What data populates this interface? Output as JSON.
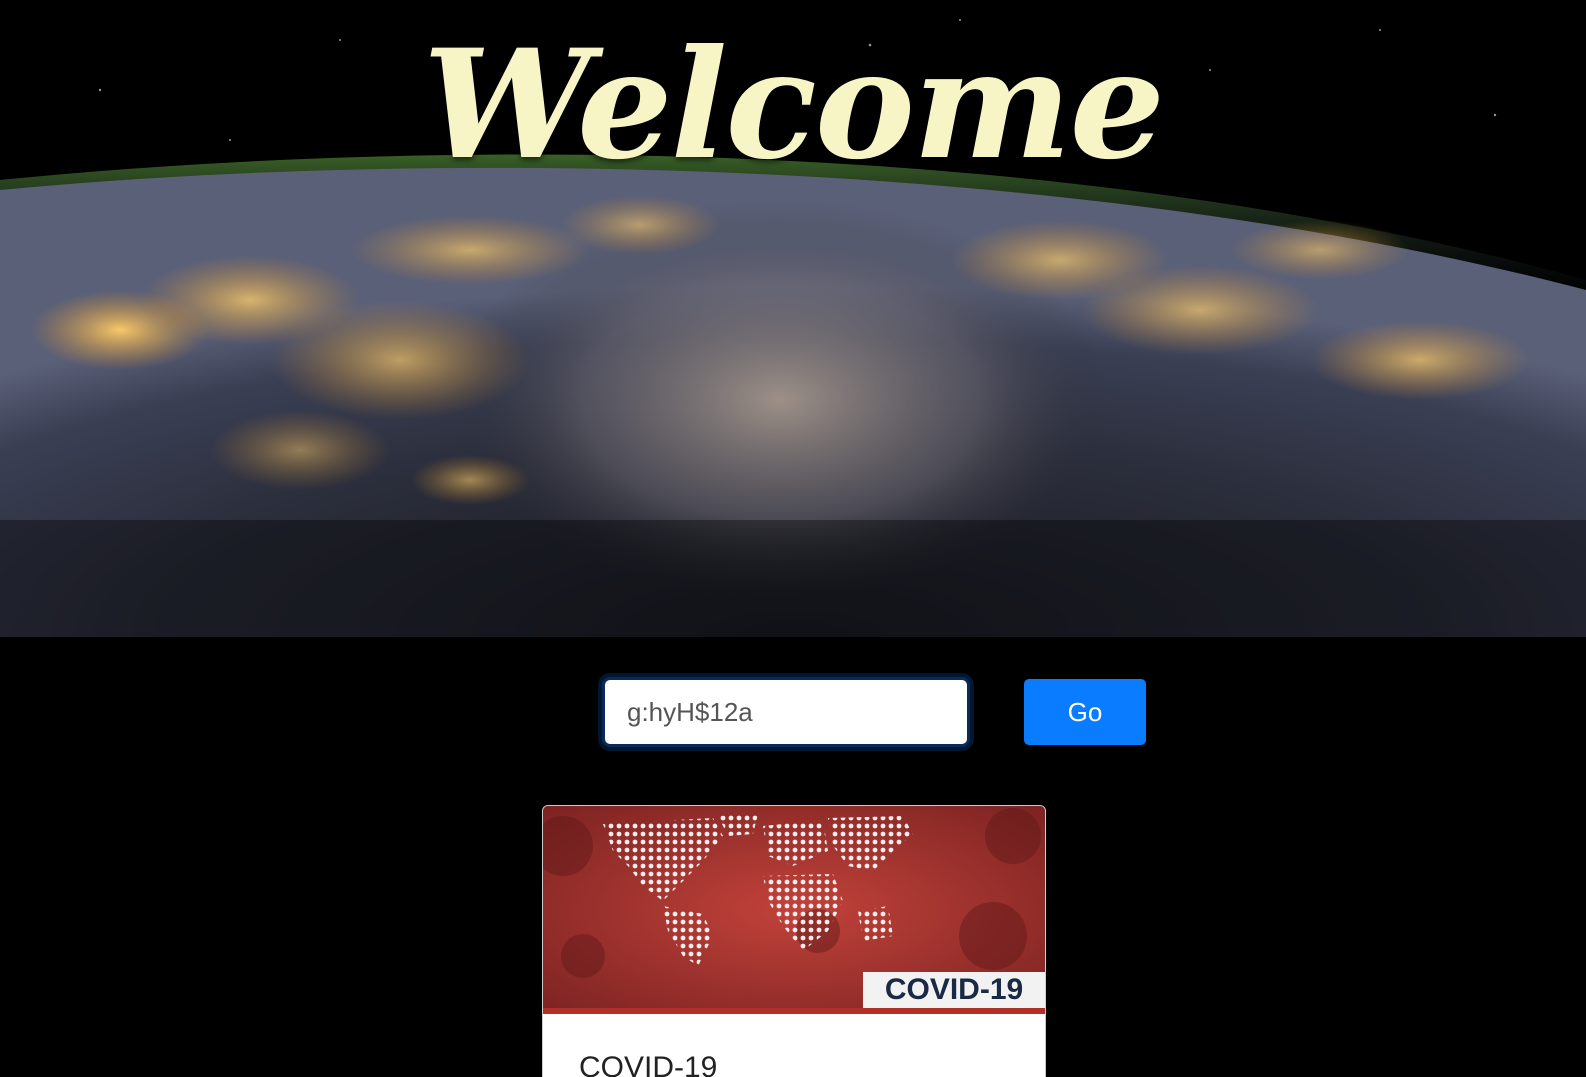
{
  "hero": {
    "title": "Welcome"
  },
  "search": {
    "value": "g:hyH$12a",
    "button_label": "Go"
  },
  "card": {
    "image_tag": "COVID-19",
    "title": "COVID-19"
  }
}
